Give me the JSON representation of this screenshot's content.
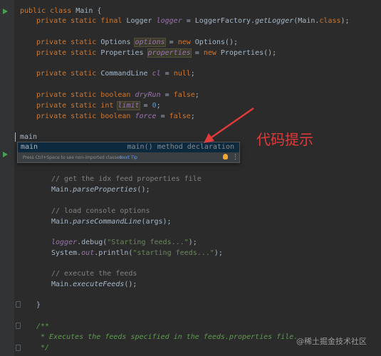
{
  "editor": {
    "lines": {
      "l1": {
        "a": "public class",
        "b": " Main {"
      },
      "l2": {
        "a": "private static final",
        "b": " Logger ",
        "c": "logger",
        "d": " = LoggerFactory.",
        "e": "getLogger",
        "f": "(Main.",
        "g": "class",
        "h": ");"
      },
      "l3": {
        "a": "private static",
        "b": " Options ",
        "c": "options",
        "d": " = ",
        "e": "new",
        "f": " Options();"
      },
      "l4": {
        "a": "private static",
        "b": " Properties ",
        "c": "properties",
        "d": " = ",
        "e": "new",
        "f": " Properties();"
      },
      "l5": {
        "a": "private static",
        "b": " CommandLine ",
        "c": "cl",
        "d": " = ",
        "e": "null",
        "f": ";"
      },
      "l6": {
        "a": "private static boolean",
        "b": " dryRun",
        "c": " = ",
        "d": "false",
        "e": ";"
      },
      "l7": {
        "a": "private static int",
        "b": " ",
        "c": "limit",
        "d": " = ",
        "e": "0",
        "f": ";"
      },
      "l8": {
        "a": "private static boolean",
        "b": " force",
        "c": " = ",
        "d": "false",
        "e": ";"
      },
      "l9": {
        "a": "main"
      },
      "l10": {
        "a": "// get the idx feed properties file"
      },
      "l11": {
        "a": "Main.",
        "b": "parseProperties",
        "c": "();"
      },
      "l12": {
        "a": "// load console options"
      },
      "l13": {
        "a": "Main.",
        "b": "parseCommandLine",
        "c": "(args);"
      },
      "l14": {
        "a": "logger",
        "b": ".debug(",
        "c": "\"Starting feeds...\"",
        "d": ");"
      },
      "l15": {
        "a": "System.",
        "b": "out",
        "c": ".println(",
        "d": "\"starting feeds...\"",
        "e": ");"
      },
      "l16": {
        "a": "// execute the feeds"
      },
      "l17": {
        "a": "Main.",
        "b": "executeFeeds",
        "c": "();"
      },
      "l18": {
        "a": "}"
      },
      "l19": {
        "a": "/**"
      },
      "l20": {
        "a": " * Executes the feeds specified in the feeds.properties file."
      },
      "l21": {
        "a": " */"
      }
    }
  },
  "completion": {
    "item_name": "main",
    "item_tail": "main() method declaration",
    "hint": "Press Ctrl+Space to see non-imported classes",
    "next_tip": "Next Tip",
    "more_glyph": "⋮"
  },
  "annotation": {
    "text": "代码提示",
    "color": "#e03a3a"
  },
  "watermark": "@稀土掘金技术社区"
}
